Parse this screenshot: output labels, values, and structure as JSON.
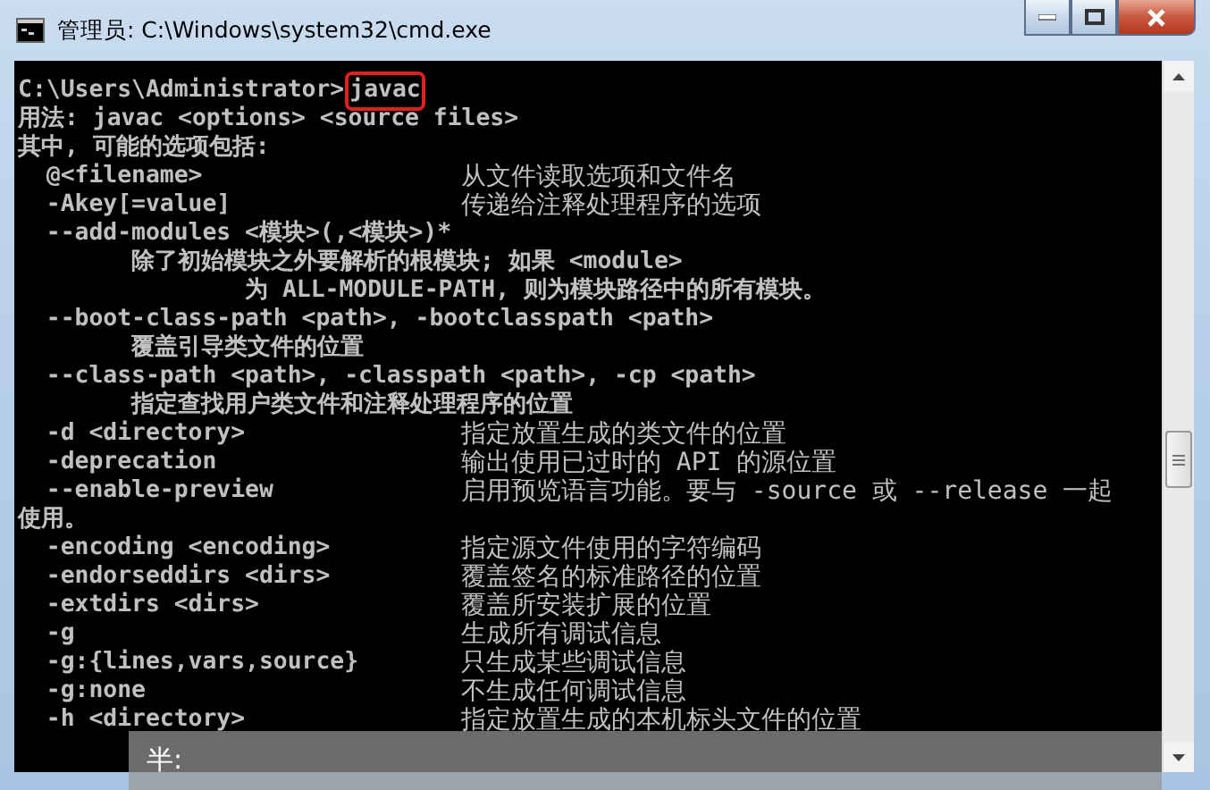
{
  "window": {
    "title": "管理员: C:\\Windows\\system32\\cmd.exe"
  },
  "prompt": {
    "path": "C:\\Users\\Administrator>",
    "command": "javac",
    "highlighted": true
  },
  "lines": [
    {
      "text": "用法: javac <options> <source files>"
    },
    {
      "text": "其中, 可能的选项包括:"
    },
    {
      "text": "  @<filename>",
      "description": "从文件读取选项和文件名"
    },
    {
      "text": "  -Akey[=value]",
      "description": "传递给注释处理程序的选项"
    },
    {
      "text": "  --add-modules <模块>(,<模块>)*"
    },
    {
      "text": "        除了初始模块之外要解析的根模块; 如果 <module>"
    },
    {
      "text": "                为 ALL-MODULE-PATH, 则为模块路径中的所有模块。"
    },
    {
      "text": "  --boot-class-path <path>, -bootclasspath <path>"
    },
    {
      "text": "        覆盖引导类文件的位置"
    },
    {
      "text": "  --class-path <path>, -classpath <path>, -cp <path>"
    },
    {
      "text": "        指定查找用户类文件和注释处理程序的位置"
    },
    {
      "text": "  -d <directory>",
      "description": "指定放置生成的类文件的位置"
    },
    {
      "text": "  -deprecation",
      "description": "输出使用已过时的 API 的源位置"
    },
    {
      "text": "  --enable-preview",
      "description": "启用预览语言功能。要与 -source 或 --release 一起"
    },
    {
      "text": "使用。"
    },
    {
      "text": "  -encoding <encoding>",
      "description": "指定源文件使用的字符编码"
    },
    {
      "text": "  -endorseddirs <dirs>",
      "description": "覆盖签名的标准路径的位置"
    },
    {
      "text": "  -extdirs <dirs>",
      "description": "覆盖所安装扩展的位置"
    },
    {
      "text": "  -g",
      "description": "生成所有调试信息"
    },
    {
      "text": "  -g:{lines,vars,source}",
      "description": "只生成某些调试信息"
    },
    {
      "text": "  -g:none",
      "description": "不生成任何调试信息"
    },
    {
      "text": "  -h <directory>",
      "description": "指定放置生成的本机标头文件的位置"
    }
  ],
  "ime_bar": {
    "text": "半:"
  }
}
